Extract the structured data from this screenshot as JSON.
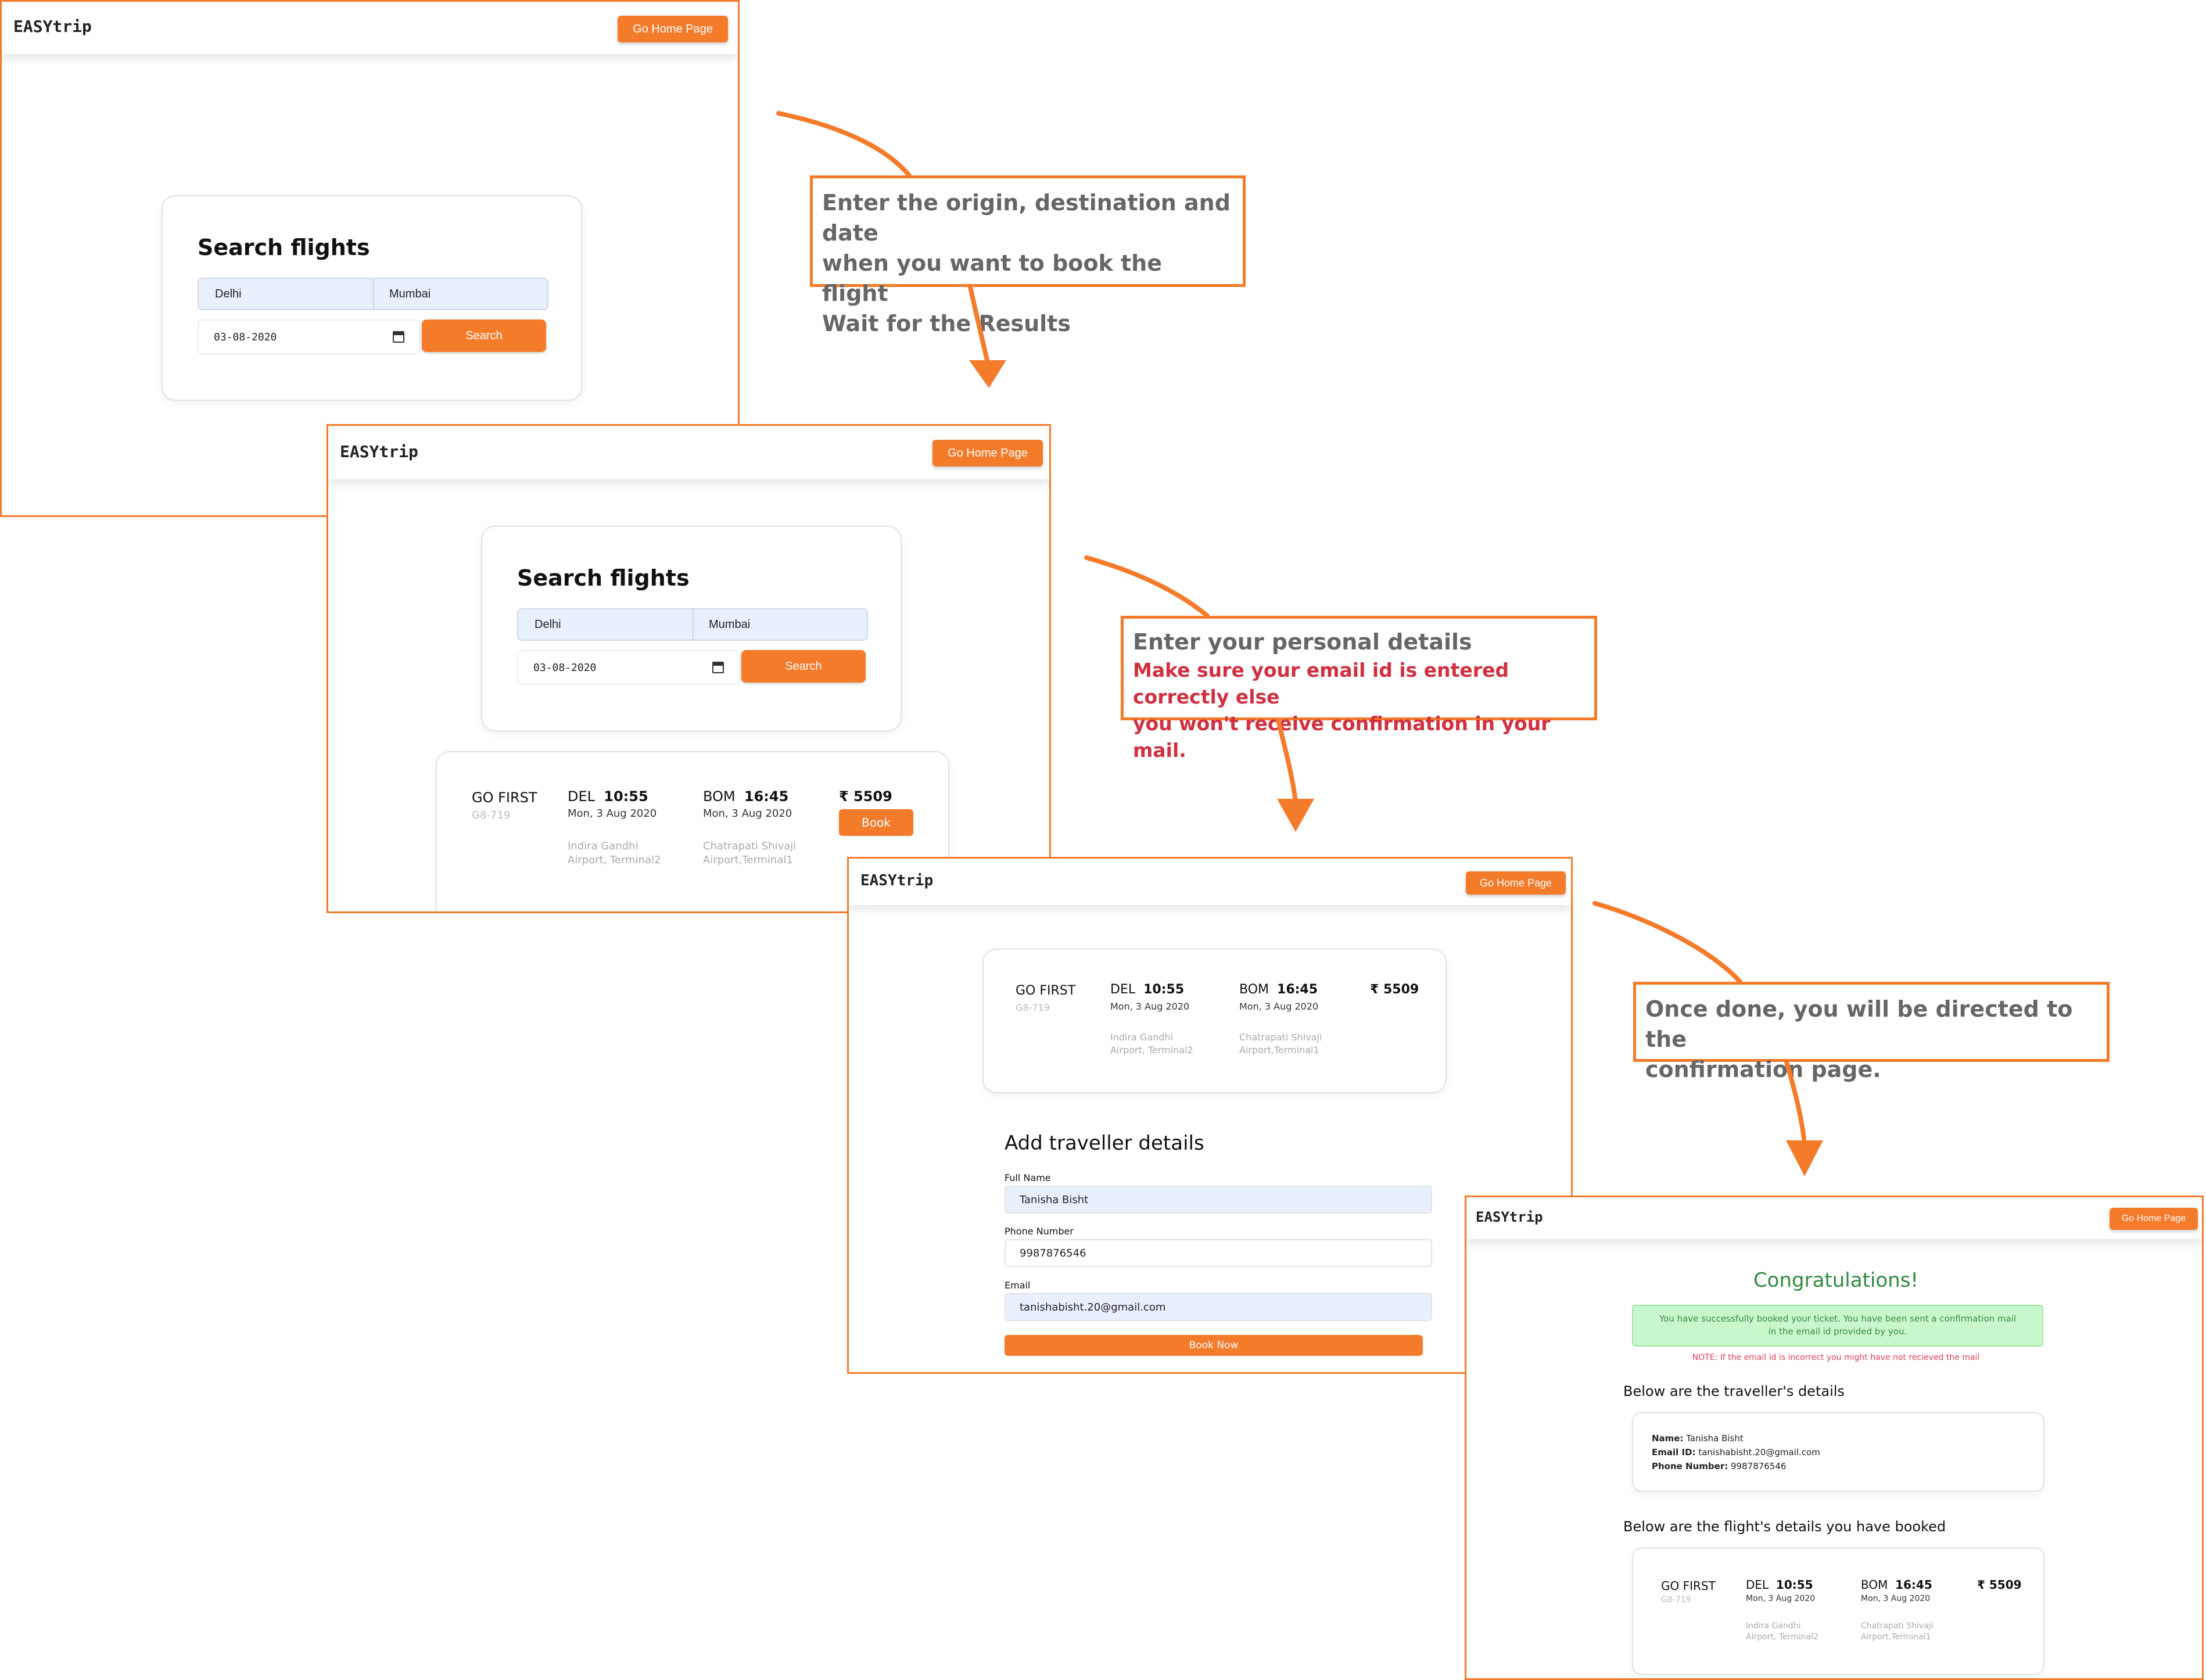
{
  "brand": "EASYtrip",
  "home_button": "Go Home Page",
  "search": {
    "title": "Search flights",
    "from": "Delhi",
    "to": "Mumbai",
    "date": "03-08-2020",
    "button": "Search"
  },
  "flight": {
    "airline": "GO FIRST",
    "number": "G8-719",
    "dep_code": "DEL",
    "dep_time": "10:55",
    "dep_date": "Mon, 3 Aug 2020",
    "dep_airport_line1": "Indira Gandhi",
    "dep_airport_line2": "Airport, Terminal2",
    "arr_code": "BOM",
    "arr_time": "16:45",
    "arr_date": "Mon, 3 Aug 2020",
    "arr_airport_line1": "Chatrapati Shivaji",
    "arr_airport_line2": "Airport,Terminal1",
    "price": "₹ 5509",
    "book_button": "Book"
  },
  "traveller_form": {
    "title": "Add traveller details",
    "full_name_label": "Full Name",
    "full_name": "Tanisha Bisht",
    "phone_label": "Phone Number",
    "phone": "9987876546",
    "email_label": "Email",
    "email": "tanishabisht.20@gmail.com",
    "submit": "Book Now"
  },
  "confirmation": {
    "title": "Congratulations!",
    "message": "You have successfully booked your ticket. You have been sent a confirmation mail in the email id provided by you.",
    "note": "NOTE: If the email id is incorrect you might have not recieved the mail",
    "traveller_heading": "Below are the traveller's details",
    "name_label": "Name:",
    "name": "Tanisha Bisht",
    "email_label": "Email ID:",
    "email": "tanishabisht.20@gmail.com",
    "phone_label": "Phone Number:",
    "phone": "9987876546",
    "flight_heading": "Below are the flight's details you have booked"
  },
  "callouts": {
    "step1_line1": "Enter the origin, destination and date",
    "step1_line2": "when you want to book the flight",
    "step1_line3": "Wait for the Results",
    "step2_line1": "Enter your personal details",
    "step2_warn1": "Make sure your email id is entered correctly else",
    "step2_warn2": "you won't receive confirmation in your mail.",
    "step3_line1": "Once done, you will be directed to the",
    "step3_line2": "confirmation page."
  },
  "colors": {
    "accent": "#f47b2a",
    "input_blue": "#e8f0fe",
    "success_green": "#c9f7cc",
    "warning_red": "#d03040"
  }
}
